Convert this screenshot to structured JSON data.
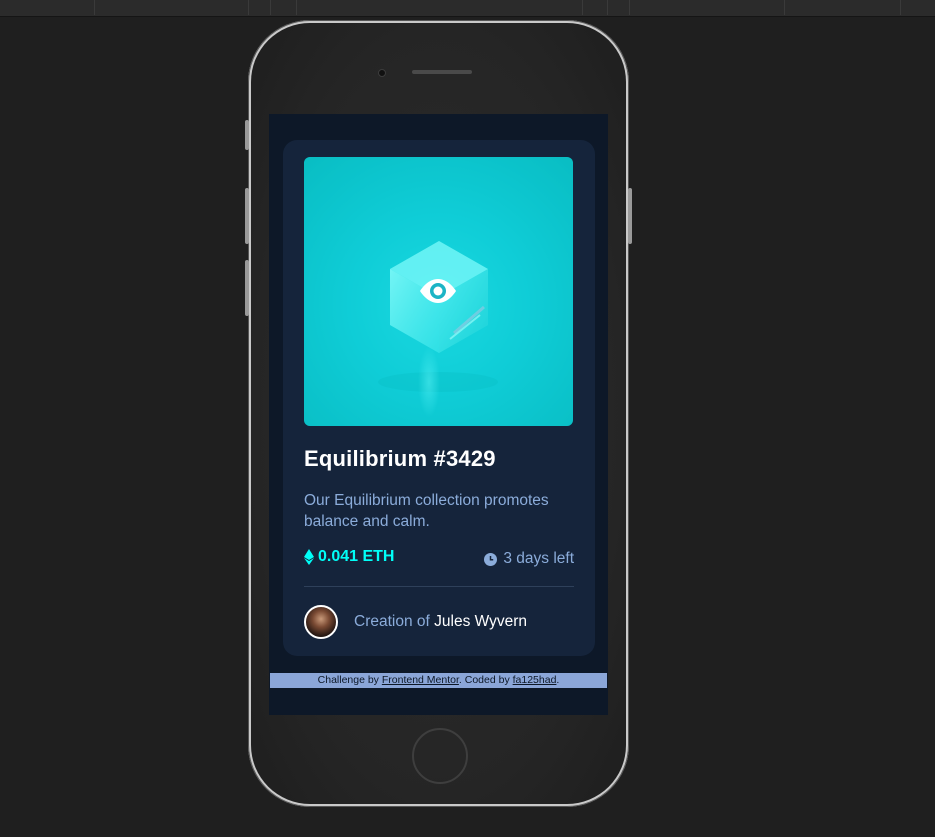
{
  "nft": {
    "title": "Equilibrium #3429",
    "description": "Our Equilibrium collection promotes balance and calm.",
    "price": "0.041 ETH",
    "time_left": "3 days left",
    "creator_prefix": "Creation of",
    "creator_name": "Jules Wyvern"
  },
  "attribution": {
    "prefix": "Challenge by",
    "link1": "Frontend Mentor",
    "middle": ". Coded by",
    "link2": "fa125had",
    "suffix": "."
  },
  "icons": {
    "hero_overlay": "eye-icon",
    "price": "ethereum-icon",
    "time": "clock-icon"
  },
  "colors": {
    "page_bg": "#0d1828",
    "card_bg": "#15243b",
    "cyan": "#00fff8",
    "soft_blue": "#8bacda",
    "white": "#ffffff"
  }
}
